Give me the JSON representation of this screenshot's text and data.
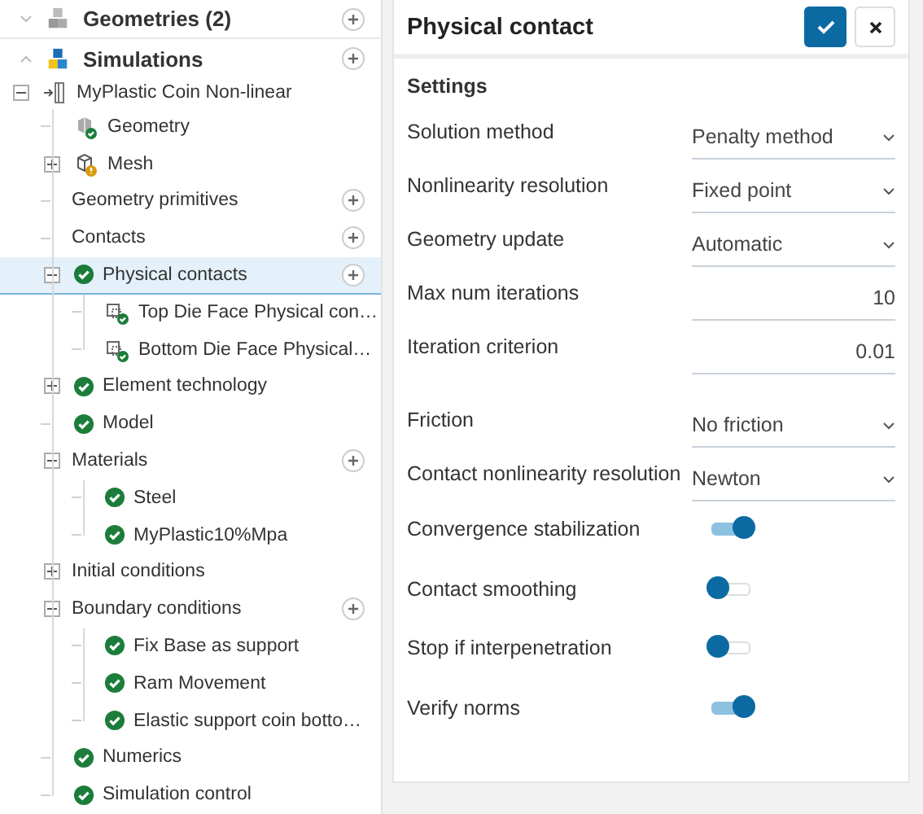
{
  "sidebar": {
    "sections": [
      {
        "label": "Geometries (2)",
        "kind": "geometries",
        "expanded": false,
        "has_add": true
      },
      {
        "label": "Simulations",
        "kind": "simulations",
        "expanded": true,
        "has_add": true
      }
    ],
    "tree": [
      {
        "label": "MyPlastic Coin Non-linear",
        "kind": "simulation",
        "expanded": true,
        "has_add": false,
        "selected": false,
        "children": [
          {
            "label": "Geometry",
            "kind": "geometry",
            "has_add": false,
            "selected": false
          },
          {
            "label": "Mesh",
            "kind": "mesh",
            "expanded": false,
            "has_add": false,
            "selected": false
          },
          {
            "label": "Geometry primitives",
            "kind": "group",
            "has_add": true,
            "selected": false
          },
          {
            "label": "Contacts",
            "kind": "group",
            "has_add": true,
            "selected": false
          },
          {
            "label": "Physical contacts",
            "kind": "valid",
            "expanded": true,
            "has_add": true,
            "selected": true,
            "children": [
              {
                "label": "Top Die Face Physical con…",
                "kind": "contact",
                "has_add": false,
                "selected": false
              },
              {
                "label": "Bottom Die Face Physical…",
                "kind": "contact",
                "has_add": false,
                "selected": false
              }
            ]
          },
          {
            "label": "Element technology",
            "kind": "valid",
            "expanded": false,
            "has_add": false,
            "selected": false
          },
          {
            "label": "Model",
            "kind": "valid",
            "has_add": false,
            "selected": false
          },
          {
            "label": "Materials",
            "kind": "group",
            "expanded": true,
            "has_add": true,
            "selected": false,
            "children": [
              {
                "label": "Steel",
                "kind": "valid",
                "has_add": false,
                "selected": false
              },
              {
                "label": "MyPlastic10%Mpa",
                "kind": "valid",
                "has_add": false,
                "selected": false
              }
            ]
          },
          {
            "label": "Initial conditions",
            "kind": "group",
            "expanded": false,
            "has_add": false,
            "selected": false
          },
          {
            "label": "Boundary conditions",
            "kind": "group",
            "expanded": true,
            "has_add": true,
            "selected": false,
            "children": [
              {
                "label": "Fix Base as support",
                "kind": "valid",
                "has_add": false,
                "selected": false
              },
              {
                "label": "Ram Movement",
                "kind": "valid",
                "has_add": false,
                "selected": false
              },
              {
                "label": "Elastic support coin botto…",
                "kind": "valid",
                "has_add": false,
                "selected": false
              }
            ]
          },
          {
            "label": "Numerics",
            "kind": "valid",
            "has_add": false,
            "selected": false
          },
          {
            "label": "Simulation control",
            "kind": "valid",
            "has_add": false,
            "selected": false
          }
        ]
      }
    ]
  },
  "panel": {
    "title": "Physical contact",
    "section": "Settings",
    "fields": [
      {
        "kind": "select",
        "label": "Solution method",
        "value": "Penalty method"
      },
      {
        "kind": "select",
        "label": "Nonlinearity resolution",
        "value": "Fixed point"
      },
      {
        "kind": "select",
        "label": "Geometry update",
        "value": "Automatic"
      },
      {
        "kind": "number",
        "label": "Max num iterations",
        "value": "10"
      },
      {
        "kind": "number",
        "label": "Iteration criterion",
        "value": "0.01"
      },
      {
        "kind": "select",
        "label": "Friction",
        "value": "No friction",
        "spaced": true
      },
      {
        "kind": "select",
        "label": "Contact nonlinearity resolution",
        "value": "Newton"
      },
      {
        "kind": "toggle",
        "label": "Convergence stabilization",
        "on": true
      },
      {
        "kind": "toggle",
        "label": "Contact smoothing",
        "on": false
      },
      {
        "kind": "toggle",
        "label": "Stop if interpenetration",
        "on": false
      },
      {
        "kind": "toggle",
        "label": "Verify norms",
        "on": true
      }
    ]
  }
}
